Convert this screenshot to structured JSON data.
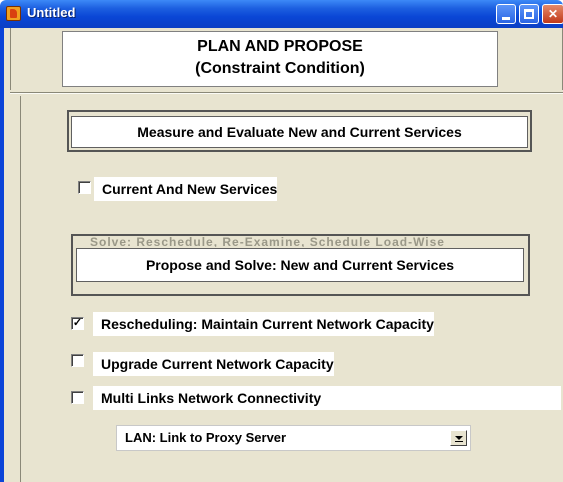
{
  "window": {
    "title": "Untitled"
  },
  "header": {
    "line1": "PLAN AND PROPOSE",
    "line2": "(Constraint Condition)"
  },
  "sections": {
    "measure": "Measure and Evaluate New and Current Services",
    "propose": "Propose and Solve: New and Current Services",
    "propose_partially_hidden": "Solve: Reschedule, Re-Examine, Schedule Load-Wise"
  },
  "checkboxes": [
    {
      "label": "Current And New Services",
      "checked": false
    },
    {
      "label": "Rescheduling: Maintain Current Network Capacity",
      "checked": true
    },
    {
      "label": "Upgrade Current Network Capacity",
      "checked": false
    },
    {
      "label": "Multi Links Network Connectivity",
      "checked": false
    }
  ],
  "dropdown": {
    "selected": "LAN: Link to Proxy Server"
  },
  "colors": {
    "titlebar": "#0a46d6",
    "panel_background": "#e8e4d0",
    "window_border": "#0b44d8"
  }
}
